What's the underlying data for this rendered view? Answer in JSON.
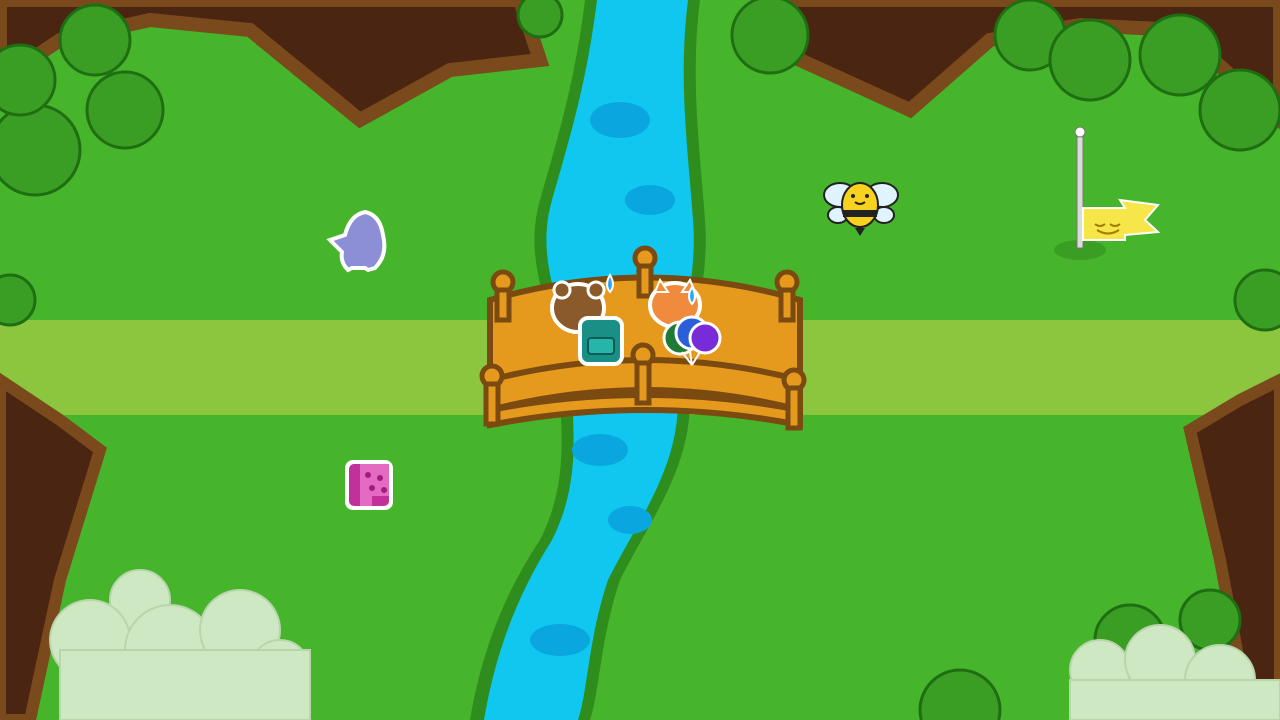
{
  "scene": {
    "colors": {
      "grass": "#47b52c",
      "path": "#8cc63f",
      "tree_trunk": "#4a2511",
      "tree_outline": "#7a4a1d",
      "bush": "#3a9e24",
      "bush_outline": "#1f6e12",
      "river": "#0fc7ef",
      "river_dark": "#0aa6e0",
      "river_bank": "#2f8d1e",
      "bridge": "#e69a1d",
      "bridge_outline": "#7a4a10",
      "cloud": "#cfe8c4"
    }
  },
  "characters": [
    {
      "name": "bird-silhouette",
      "color": "#8d8fd6"
    },
    {
      "name": "bee",
      "color": "#f7d21e"
    },
    {
      "name": "bear-with-backpack",
      "color": "#8b5a2b"
    },
    {
      "name": "fox-with-balloons",
      "color": "#f08a3c"
    }
  ],
  "items": [
    {
      "name": "goal-flag",
      "color": "#f7e64a"
    },
    {
      "name": "pink-sticker-card",
      "color": "#c2309a"
    },
    {
      "name": "teal-backpack",
      "color": "#1a8f86"
    },
    {
      "name": "balloons",
      "colors": [
        "#1f7a35",
        "#2b5fd8",
        "#7a2bd8"
      ]
    }
  ]
}
